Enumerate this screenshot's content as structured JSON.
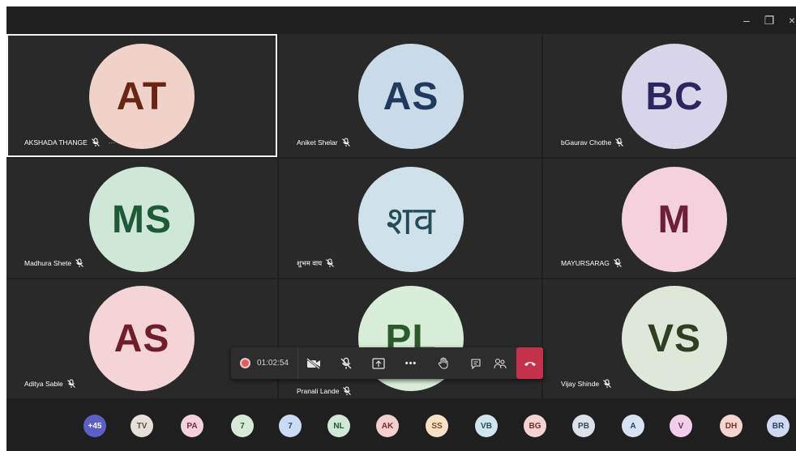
{
  "window": {
    "minimize_label": "–",
    "restore_label": "❐",
    "close_label": "×"
  },
  "participants": [
    {
      "initials": "AT",
      "name": "AKSHADA THANGE",
      "bg": "#f1d2c8",
      "fg": "#6b2515"
    },
    {
      "initials": "AS",
      "name": "Aniket Shelar",
      "bg": "#c9dbe9",
      "fg": "#1f3a5c"
    },
    {
      "initials": "BC",
      "name": "bGaurav Chothe",
      "bg": "#d8d4ea",
      "fg": "#2b275e"
    },
    {
      "initials": "MS",
      "name": "Madhura Shete",
      "bg": "#cfe7d6",
      "fg": "#1f5a36"
    },
    {
      "initials": "शव",
      "name": "शुभम वाघ",
      "bg": "#cfe2ea",
      "fg": "#254b5a"
    },
    {
      "initials": "M",
      "name": "MAYURSARAG",
      "bg": "#f5d1de",
      "fg": "#6e1f38"
    },
    {
      "initials": "AS",
      "name": "Aditya Sable",
      "bg": "#f5d4d8",
      "fg": "#6e1f2a"
    },
    {
      "initials": "PL",
      "name": "Pranali Lande",
      "bg": "#d9eed9",
      "fg": "#2b5a2b"
    },
    {
      "initials": "VS",
      "name": "Vijay Shinde",
      "bg": "#dfe8d8",
      "fg": "#2f3f22"
    }
  ],
  "more_indicator": "···",
  "controls": {
    "timer": "01:02:54",
    "more_label": "•••"
  },
  "overflow": [
    {
      "label": "+45",
      "bg": "#5b5fc7",
      "fg": "#ffffff"
    },
    {
      "label": "TV",
      "bg": "#e5e0da",
      "fg": "#5a4f44"
    },
    {
      "label": "PA",
      "bg": "#f5d1dd",
      "fg": "#7a2a45"
    },
    {
      "label": "7",
      "bg": "#d7ead7",
      "fg": "#2f5a2f"
    },
    {
      "label": "7",
      "bg": "#c9dbf5",
      "fg": "#2a4a7a"
    },
    {
      "label": "NL",
      "bg": "#cfe9d6",
      "fg": "#245a36"
    },
    {
      "label": "AK",
      "bg": "#f3cfcf",
      "fg": "#7a2a2a"
    },
    {
      "label": "SS",
      "bg": "#f8e0c4",
      "fg": "#7a5020"
    },
    {
      "label": "VB",
      "bg": "#cfe6ee",
      "fg": "#24505e"
    },
    {
      "label": "BG",
      "bg": "#f5d3d3",
      "fg": "#7a2a2a"
    },
    {
      "label": "PB",
      "bg": "#dde2ea",
      "fg": "#3a4456"
    },
    {
      "label": "A",
      "bg": "#d7e3f2",
      "fg": "#2a4466"
    },
    {
      "label": "V",
      "bg": "#f2cfe8",
      "fg": "#6e2a5e"
    },
    {
      "label": "DH",
      "bg": "#f6d4cf",
      "fg": "#7a3222"
    },
    {
      "label": "BR",
      "bg": "#cfdaf2",
      "fg": "#2a3f6e"
    }
  ]
}
